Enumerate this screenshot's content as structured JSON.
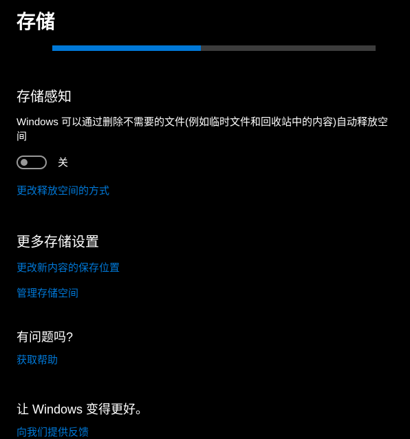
{
  "page": {
    "title": "存储"
  },
  "progress": {
    "percent": 46
  },
  "storageSense": {
    "title": "存储感知",
    "description": "Windows 可以通过删除不需要的文件(例如临时文件和回收站中的内容)自动释放空间",
    "toggleState": "关",
    "link": "更改释放空间的方式"
  },
  "moreSettings": {
    "title": "更多存储设置",
    "links": {
      "saveLocation": "更改新内容的保存位置",
      "manageStorage": "管理存储空间"
    }
  },
  "help": {
    "title": "有问题吗?",
    "link": "获取帮助"
  },
  "better": {
    "title": "让 Windows 变得更好。",
    "link": "向我们提供反馈"
  }
}
